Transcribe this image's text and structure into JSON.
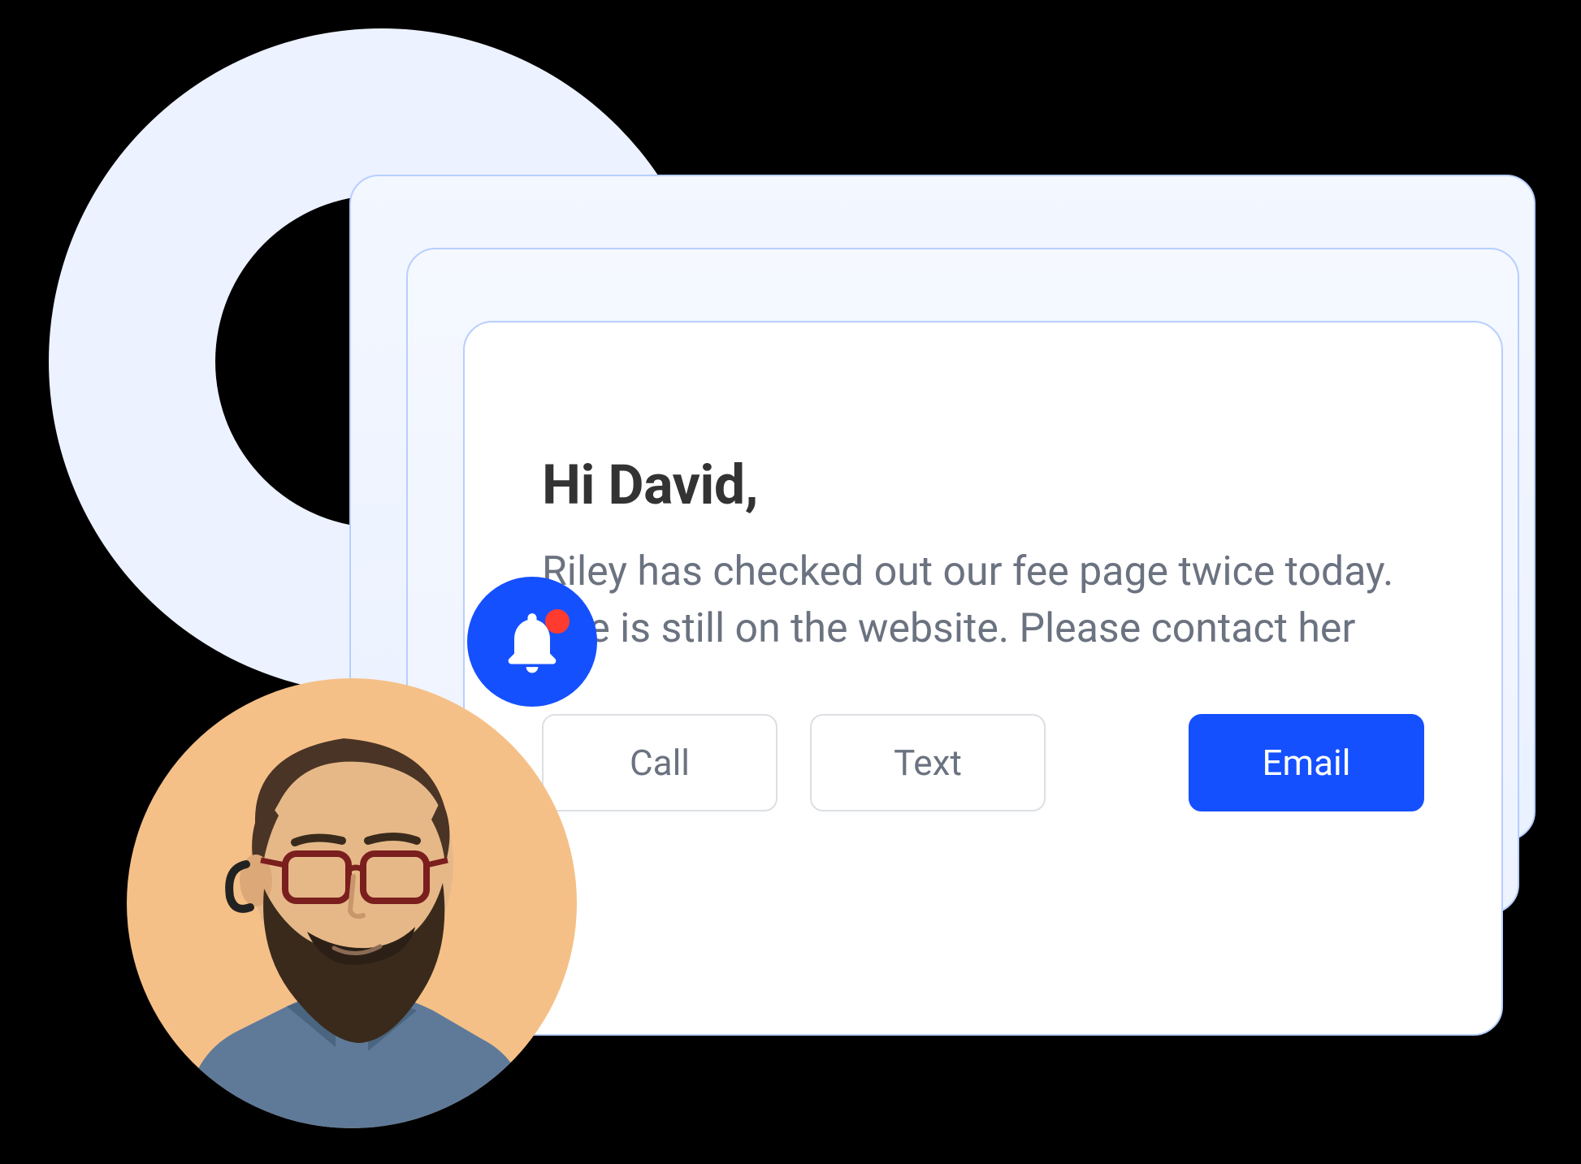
{
  "notification": {
    "greeting": "Hi David,",
    "message": "Riley has checked out our fee page twice today. She is still on the website. Please contact her",
    "actions": {
      "call": "Call",
      "text": "Text",
      "email": "Email"
    }
  },
  "icons": {
    "bell": "bell-icon",
    "avatar": "avatar"
  },
  "colors": {
    "accent": "#1550ff",
    "alert": "#ff3b30",
    "ring": "#ecf2ff",
    "avatarBg": "#f5c087"
  }
}
